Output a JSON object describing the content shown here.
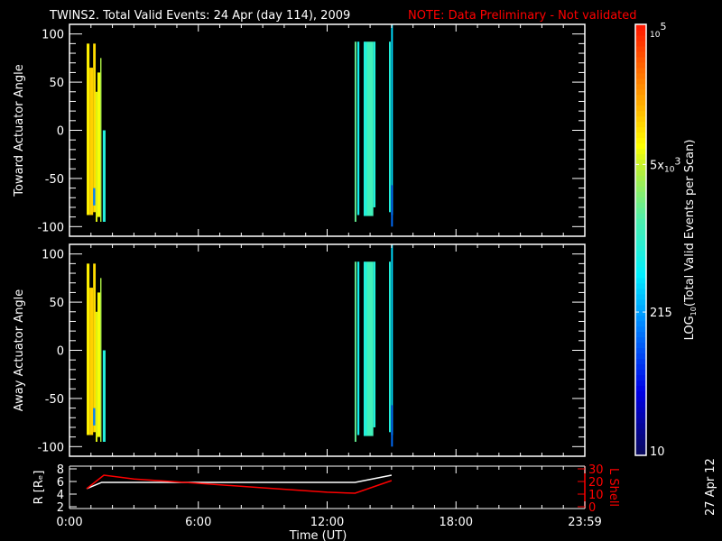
{
  "title": "TWINS2. Total Valid Events: 24 Apr (day 114), 2009",
  "note": "NOTE: Data Preliminary - Not validated",
  "date_stamp": "27 Apr 12",
  "colors": {
    "note": "#ff0000",
    "axes": "#ffffff",
    "lshell": "#ff0000",
    "radius": "#ffffff"
  },
  "chart_data": [
    {
      "type": "heatmap",
      "ylabel": "Toward Actuator Angle",
      "ylim": [
        -110,
        110
      ],
      "yticks": [
        "100",
        "50",
        "0",
        "-50",
        "-100"
      ],
      "ytick_values": [
        100,
        50,
        0,
        -50,
        -100
      ],
      "xlim_hours": [
        0,
        24
      ],
      "bars": [
        [
          0.8,
          0.93,
          -88,
          90,
          3.95
        ],
        [
          0.93,
          1.1,
          -88,
          65,
          4.1
        ],
        [
          1.1,
          1.22,
          -85,
          90,
          4.05
        ],
        [
          1.22,
          1.3,
          -95,
          40,
          3.8
        ],
        [
          1.3,
          1.43,
          -90,
          60,
          3.85
        ],
        [
          1.43,
          1.49,
          -95,
          75,
          3.6
        ],
        [
          1.55,
          1.68,
          -95,
          0,
          2.9
        ],
        [
          1.1,
          1.2,
          -78,
          -60,
          2.2
        ],
        [
          13.28,
          13.36,
          -95,
          92,
          3.3
        ],
        [
          13.4,
          13.5,
          -88,
          92,
          2.8
        ],
        [
          13.7,
          13.85,
          -89,
          92,
          2.9
        ],
        [
          13.85,
          14.15,
          -89,
          92,
          3.1
        ],
        [
          14.15,
          14.25,
          -80,
          92,
          2.9
        ],
        [
          14.88,
          14.96,
          -85,
          92,
          2.9
        ],
        [
          14.98,
          15.06,
          -88,
          110,
          2.6
        ],
        [
          14.98,
          15.06,
          -100,
          -57,
          2.1
        ]
      ]
    },
    {
      "type": "heatmap",
      "ylabel": "Away Actuator Angle",
      "ylim": [
        -110,
        110
      ],
      "yticks": [
        "100",
        "50",
        "0",
        "-50",
        "-100"
      ],
      "ytick_values": [
        100,
        50,
        0,
        -50,
        -100
      ],
      "xlim_hours": [
        0,
        24
      ],
      "bars": [
        [
          0.8,
          0.93,
          -88,
          90,
          3.95
        ],
        [
          0.93,
          1.1,
          -88,
          65,
          4.1
        ],
        [
          1.1,
          1.22,
          -85,
          90,
          4.05
        ],
        [
          1.22,
          1.3,
          -95,
          40,
          3.8
        ],
        [
          1.3,
          1.43,
          -90,
          60,
          3.85
        ],
        [
          1.43,
          1.49,
          -95,
          75,
          3.6
        ],
        [
          1.55,
          1.68,
          -95,
          0,
          2.9
        ],
        [
          1.1,
          1.2,
          -78,
          -60,
          2.2
        ],
        [
          13.28,
          13.36,
          -95,
          92,
          3.3
        ],
        [
          13.4,
          13.5,
          -88,
          92,
          2.8
        ],
        [
          13.7,
          13.85,
          -89,
          92,
          2.9
        ],
        [
          13.85,
          14.15,
          -89,
          92,
          3.1
        ],
        [
          14.15,
          14.25,
          -80,
          92,
          2.9
        ],
        [
          14.88,
          14.96,
          -85,
          92,
          2.9
        ],
        [
          14.98,
          15.06,
          -88,
          110,
          2.6
        ],
        [
          14.98,
          15.06,
          -100,
          -57,
          2.1
        ]
      ]
    },
    {
      "type": "line",
      "ylabel": "R [Rₑ]",
      "y2label": "L Shell",
      "xlabel": "Time (UT)",
      "ylim": [
        2,
        8
      ],
      "y2lim": [
        0,
        30
      ],
      "yticks": [
        "2",
        "4",
        "6",
        "8"
      ],
      "y2ticks": [
        "0",
        "10",
        "20",
        "30"
      ],
      "xticks": [
        "0:00",
        "6:00",
        "12:00",
        "18:00",
        "23:59"
      ],
      "xtick_hours": [
        0,
        6,
        12,
        18,
        24
      ],
      "series": [
        {
          "name": "R",
          "axis": "left",
          "x": [
            0.8,
            1.5,
            13.3,
            15.0
          ],
          "y": [
            4.86,
            5.86,
            5.86,
            7.0
          ]
        },
        {
          "name": "L Shell",
          "axis": "right",
          "x": [
            0.8,
            1.6,
            3,
            6,
            9,
            12,
            13.3,
            15.0
          ],
          "y": [
            14.3,
            25,
            22,
            18.6,
            15,
            11.5,
            10.7,
            20.7
          ]
        }
      ]
    }
  ],
  "colorbar": {
    "label": "LOG10(Total Valid Events per Scan)",
    "label_main": "LOG",
    "label_sub": "10",
    "label_rest": "(Total Valid Events per Scan)",
    "range_log": [
      1,
      5
    ],
    "ticks": [
      {
        "base": "10",
        "exp": "5",
        "value_log": 5
      },
      {
        "base": "5x",
        "mid": "10",
        "exp": "3",
        "value_log": 3.7
      },
      {
        "base": "215",
        "value_log": 2.33
      },
      {
        "base": "10",
        "value_log": 1
      }
    ]
  }
}
